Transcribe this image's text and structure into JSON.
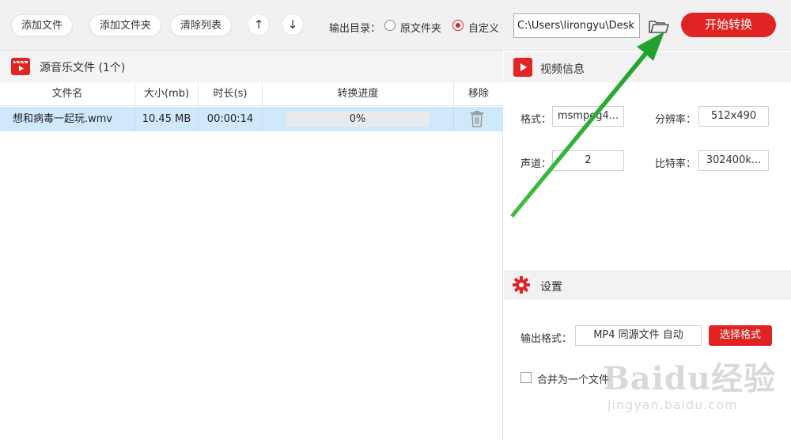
{
  "toolbar": {
    "add_file": "添加文件",
    "add_folder": "添加文件夹",
    "clear_list": "清除列表",
    "up_arrow": "↑",
    "down_arrow": "↓",
    "output_dir_label": "输出目录：",
    "option_source_folder": "原文件夹",
    "option_custom": "自定义",
    "path_value": "C:\\Users\\lirongyu\\Desk",
    "start_convert": "开始转换"
  },
  "source_list": {
    "title": "源音乐文件 (1个)",
    "columns": [
      "文件名",
      "大小(mb)",
      "时长(s)",
      "转换进度",
      "移除"
    ],
    "rows": [
      {
        "name": "想和病毒一起玩.wmv",
        "size": "10.45 MB",
        "duration": "00:00:14",
        "progress": "0%",
        "progress_value": 0
      }
    ]
  },
  "video_info": {
    "title": "视频信息",
    "format_label": "格式：",
    "format_value": "msmpeg4...",
    "resolution_label": "分辨率：",
    "resolution_value": "512x490",
    "channels_label": "声道：",
    "channels_value": "2",
    "bitrate_label": "比特率：",
    "bitrate_value": "302400k..."
  },
  "settings": {
    "title": "设置",
    "output_format_label": "输出格式：",
    "output_format_value": "MP4 同源文件 自动",
    "select_format": "选择格式",
    "merge_label": "合并为一个文件",
    "merge_checked": false
  },
  "watermark": {
    "logo": "Baidu经验",
    "url": "jingyan.baidu.com"
  },
  "colors": {
    "accent": "#e02424",
    "row_selected": "#cfe9fb",
    "annotation_arrow": "#2fae2f"
  }
}
